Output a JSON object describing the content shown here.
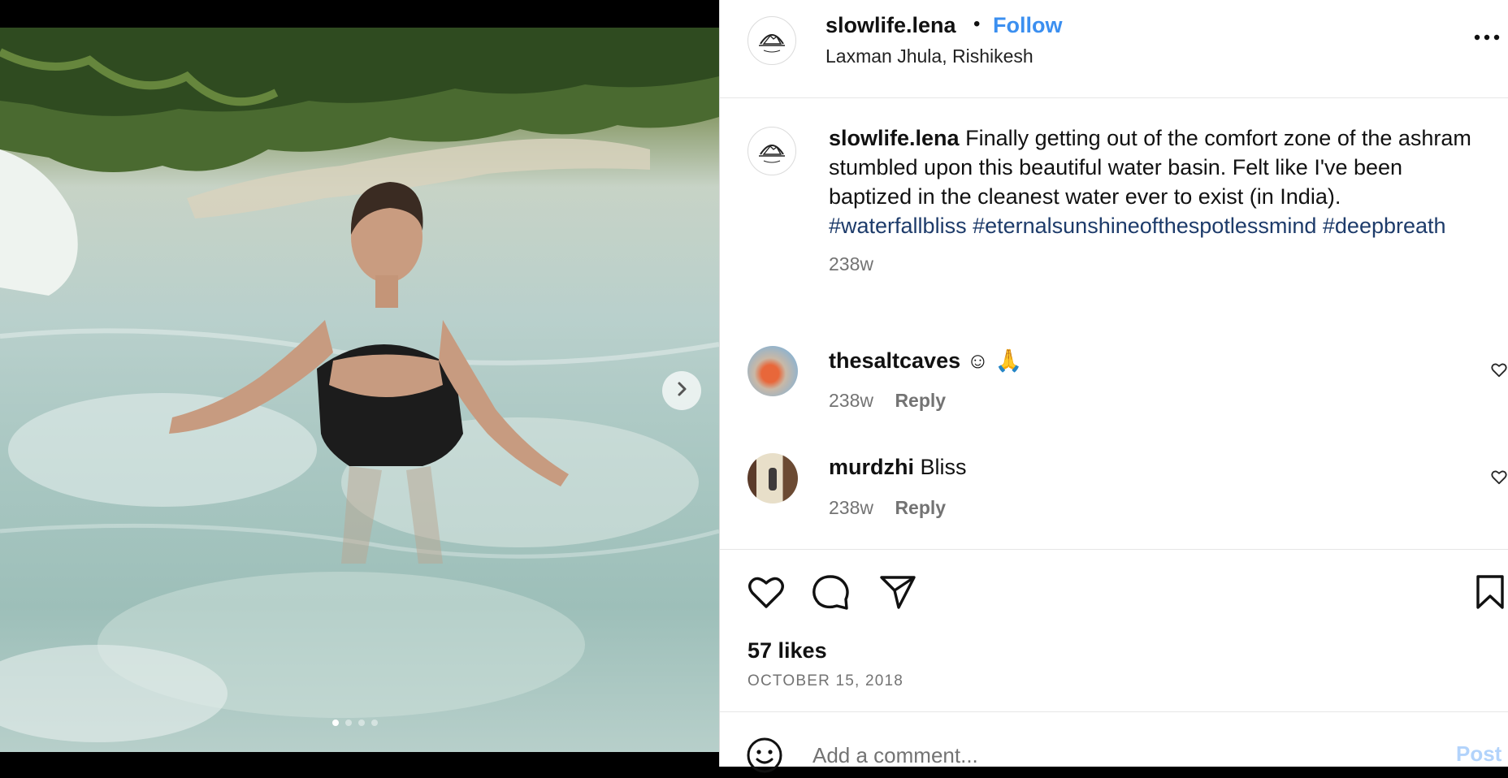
{
  "post": {
    "media": {
      "carousel": {
        "slide_count": 4,
        "active_index": 0
      },
      "next_icon": "chevron-right-icon"
    },
    "header": {
      "username": "slowlife.lena",
      "separator": "•",
      "follow_label": "Follow",
      "location": "Laxman Jhula, Rishikesh",
      "more_icon": "more-horizontal-icon"
    },
    "caption": {
      "username": "slowlife.lena",
      "text": "Finally getting out of the comfort zone of the ashram stumbled upon this beautiful water basin. Felt like I've been baptized in the cleanest water ever to exist (in India).",
      "hashtags": [
        "#waterfallbliss",
        "#eternalsunshineofthespotlessmind",
        "#deepbreath"
      ],
      "time": "238w"
    },
    "comments": [
      {
        "username": "thesaltcaves",
        "text": "☺ 🙏",
        "time": "238w",
        "reply_label": "Reply"
      },
      {
        "username": "murdzhi",
        "text": "Bliss",
        "time": "238w",
        "reply_label": "Reply"
      }
    ],
    "likes": "57 likes",
    "date": "OCTOBER 15, 2018",
    "add_comment": {
      "placeholder": "Add a comment...",
      "post_label": "Post"
    },
    "colors": {
      "follow": "#3b8ff0",
      "hashtag": "#1d3b6a",
      "muted": "#737373",
      "post_disabled": "#b2d3fb"
    }
  }
}
